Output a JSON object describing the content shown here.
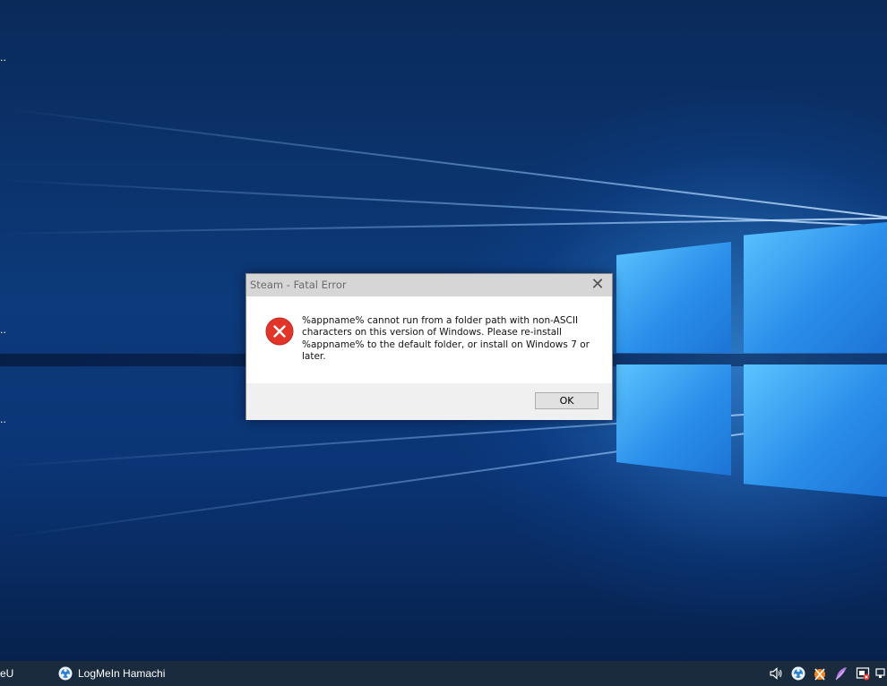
{
  "desktop": {
    "edge_labels": [
      "..",
      "..",
      ".."
    ]
  },
  "dialog": {
    "title": "Steam - Fatal Error",
    "close_glyph": "✕",
    "icon": "error-icon",
    "message": "%appname% cannot run from a folder path with non-ASCII characters on this version of Windows. Please re-install %appname% to the default folder, or install on Windows 7 or later.",
    "ok_label": "OK"
  },
  "taskbar": {
    "partial_label": "eU",
    "apps": [
      {
        "label": "LogMeIn Hamachi",
        "icon": "hamachi-icon"
      }
    ],
    "tray_icons": [
      "volume-icon",
      "hamachi-tray-icon",
      "avast-icon",
      "feather-icon",
      "security-alert-icon",
      "network-icon"
    ]
  },
  "colors": {
    "error_red": "#e3342a",
    "taskbar_bg": "#1b2b3e",
    "desktop_blue": "#0c3a7a"
  }
}
